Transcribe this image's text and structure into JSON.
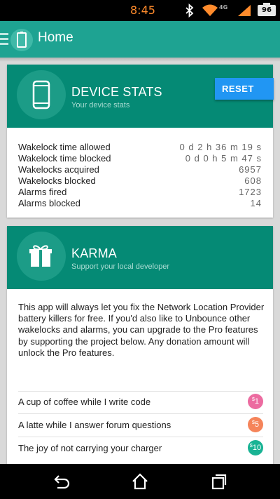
{
  "status_bar": {
    "time": "8:45",
    "battery_level": "96",
    "icons": [
      "bluetooth-icon",
      "wifi-icon",
      "signal-4g-icon",
      "cellular-signal-icon",
      "battery-icon"
    ],
    "network_label": "4G",
    "time_color": "#ff8b2c"
  },
  "app_bar": {
    "title": "Home",
    "color": "#1ea392"
  },
  "device_stats": {
    "title": "DEVICE STATS",
    "subtitle": "Your device stats",
    "reset_label": "RESET",
    "header_color": "#058a75",
    "accent_color": "#2196f3",
    "rows": [
      {
        "label": "Wakelock time allowed",
        "value": "0 d 2 h 36 m 19 s"
      },
      {
        "label": "Wakelock time blocked",
        "value": "0 d 0 h 5 m 47 s"
      },
      {
        "label": "Wakelocks acquired",
        "value": "6957"
      },
      {
        "label": "Wakelocks blocked",
        "value": "608"
      },
      {
        "label": "Alarms fired",
        "value": "1723"
      },
      {
        "label": "Alarms blocked",
        "value": "14"
      }
    ]
  },
  "karma": {
    "title": "KARMA",
    "subtitle": "Support your local developer",
    "description": "This app will always let you fix the Network Location Provider battery killers for free.  If you'd also like to Unbounce other wakelocks and alarms, you can upgrade to the Pro features by supporting the project below.  Any donation amount will unlock the Pro features.",
    "donations": [
      {
        "label": "A cup of coffee while I write code",
        "currency": "$",
        "amount": "1",
        "color": "#ec6ba0"
      },
      {
        "label": "A latte while I answer forum questions",
        "currency": "$",
        "amount": "5",
        "color": "#f5845a"
      },
      {
        "label": "The joy of not carrying your charger",
        "currency": "$",
        "amount": "10",
        "color": "#19b394"
      }
    ]
  },
  "nav_bar": {
    "buttons": [
      "back-icon",
      "home-icon",
      "recents-icon"
    ]
  }
}
